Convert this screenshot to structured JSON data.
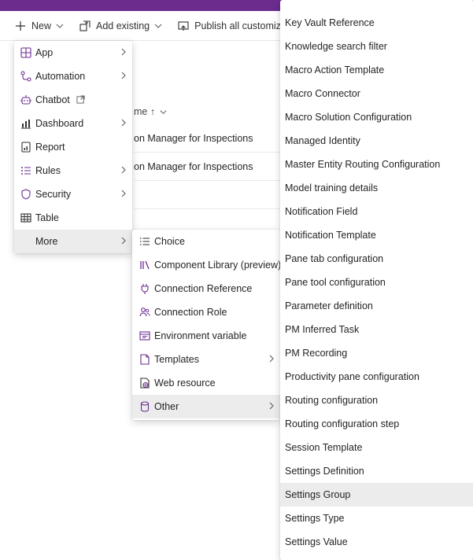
{
  "command_bar": {
    "new_label": "New",
    "add_existing_label": "Add existing",
    "publish_label": "Publish all customizations"
  },
  "background": {
    "column_header": "me ↑",
    "rows": [
      "on Manager for Inspections",
      "on Manager for Inspections"
    ]
  },
  "new_menu": {
    "items": [
      {
        "label": "App",
        "icon": "app-icon",
        "submenu": true
      },
      {
        "label": "Automation",
        "icon": "automation-icon",
        "submenu": true
      },
      {
        "label": "Chatbot",
        "icon": "chatbot-icon",
        "submenu": false,
        "external": true
      },
      {
        "label": "Dashboard",
        "icon": "dashboard-icon",
        "submenu": true
      },
      {
        "label": "Report",
        "icon": "report-icon",
        "submenu": false
      },
      {
        "label": "Rules",
        "icon": "rules-icon",
        "submenu": true
      },
      {
        "label": "Security",
        "icon": "shield-icon",
        "submenu": true
      },
      {
        "label": "Table",
        "icon": "table-icon",
        "submenu": false
      },
      {
        "label": "More",
        "icon": "",
        "submenu": true,
        "selected": true
      }
    ]
  },
  "more_menu": {
    "items": [
      {
        "label": "Choice",
        "icon": "choice-icon",
        "submenu": false
      },
      {
        "label": "Component Library (preview)",
        "icon": "library-icon",
        "submenu": false
      },
      {
        "label": "Connection Reference",
        "icon": "plug-icon",
        "submenu": false
      },
      {
        "label": "Connection Role",
        "icon": "people-icon",
        "submenu": false
      },
      {
        "label": "Environment variable",
        "icon": "variable-icon",
        "submenu": false
      },
      {
        "label": "Templates",
        "icon": "template-icon",
        "submenu": true
      },
      {
        "label": "Web resource",
        "icon": "web-resource-icon",
        "submenu": false
      },
      {
        "label": "Other",
        "icon": "database-icon",
        "submenu": true,
        "selected": true
      }
    ]
  },
  "other_menu": {
    "items": [
      {
        "label": "Key Vault Reference"
      },
      {
        "label": "Knowledge search filter"
      },
      {
        "label": "Macro Action Template"
      },
      {
        "label": "Macro Connector"
      },
      {
        "label": "Macro Solution Configuration"
      },
      {
        "label": "Managed Identity"
      },
      {
        "label": "Master Entity Routing Configuration"
      },
      {
        "label": "Model training details"
      },
      {
        "label": "Notification Field"
      },
      {
        "label": "Notification Template"
      },
      {
        "label": "Pane tab configuration"
      },
      {
        "label": "Pane tool configuration"
      },
      {
        "label": "Parameter definition"
      },
      {
        "label": "PM Inferred Task"
      },
      {
        "label": "PM Recording"
      },
      {
        "label": "Productivity pane configuration"
      },
      {
        "label": "Routing configuration"
      },
      {
        "label": "Routing configuration step"
      },
      {
        "label": "Session Template"
      },
      {
        "label": "Settings Definition"
      },
      {
        "label": "Settings Group",
        "hovered": true
      },
      {
        "label": "Settings Type"
      },
      {
        "label": "Settings Value"
      }
    ]
  },
  "colors": {
    "top_bar": "#6b2c8e",
    "icon_purple": "#6a2c91",
    "selected_bg": "#ececec"
  }
}
